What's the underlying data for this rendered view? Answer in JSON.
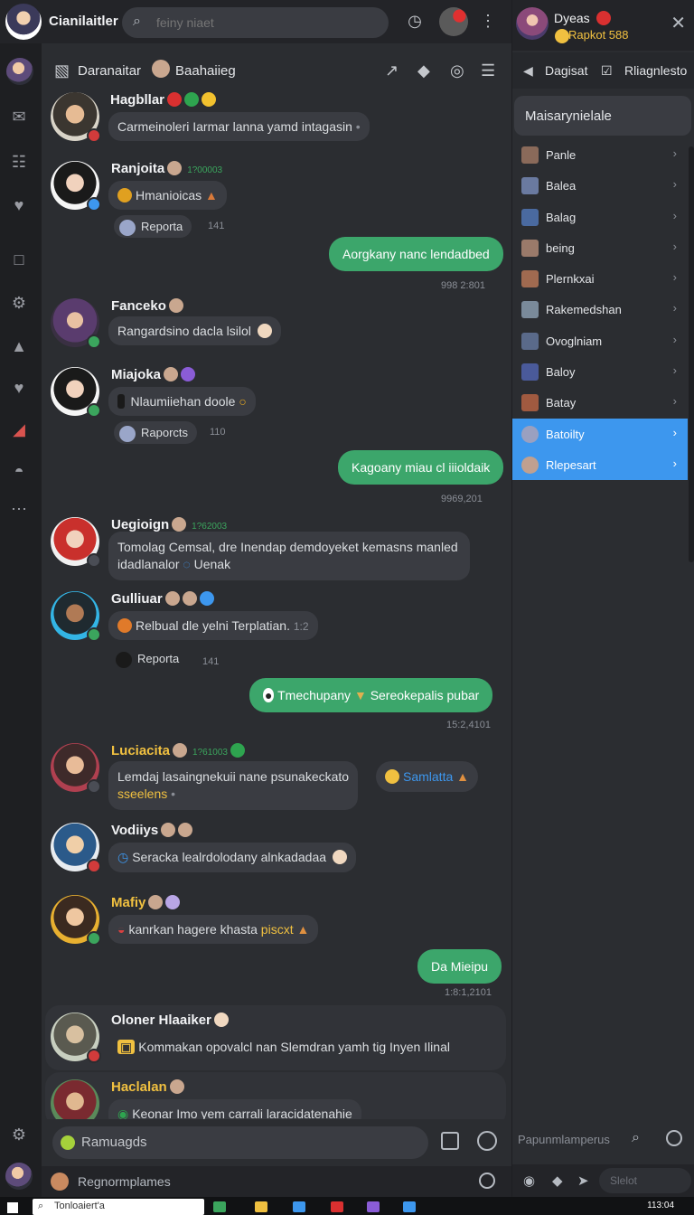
{
  "app": {
    "title": "Cianilaitler"
  },
  "search": {
    "placeholder": "feiny niaet"
  },
  "channel": {
    "name": "Daranaitar",
    "subname": "Baahaiieg"
  },
  "messages": [
    {
      "name": "Hagbllar",
      "meta": "",
      "text": "Carmeinoleri Iarmar lanna yamd intagasin",
      "reply": null,
      "rnum": ""
    },
    {
      "name": "Ranjoita",
      "meta": "1?00003",
      "text": "Hmanioicas",
      "reply": "Reporta",
      "rnum": "141"
    },
    {
      "name": "Fanceko",
      "meta": "",
      "text": "Rangardsino dacla lsilol",
      "reply": null,
      "rnum": ""
    },
    {
      "name": "Miajoka",
      "meta": "",
      "text": "Nlaumiiehan doole",
      "reply": "Raporcts",
      "rnum": "110"
    },
    {
      "name": "Uegioign",
      "meta": "1?62003",
      "text": "Tomolag Cemsal, dre Inendap demdoyeket kemasns manled",
      "text2": "idadlanalor",
      "text3": "Uenak",
      "reply": null,
      "rnum": ""
    },
    {
      "name": "Gulliuar",
      "meta": "",
      "text": "Relbual dle yelni Terplatian.",
      "text2": "1:2",
      "reply": "Reporta",
      "rnum": "141"
    },
    {
      "name": "Luciacita",
      "meta": "1?61003",
      "text": "Lemdaj lasaingnekuii nane psunakeckato",
      "text2": "sseelens",
      "reply": null,
      "rnum": ""
    },
    {
      "name": "Vodiiys",
      "meta": "",
      "text": "Seracka lealrdolodany alnkadadaa",
      "reply": null,
      "rnum": ""
    },
    {
      "name": "Mafiy",
      "meta": "",
      "text": "kanrkan hagere khasta",
      "text2": "piscxt",
      "reply": null,
      "rnum": ""
    },
    {
      "name": "Oloner Hlaaiker",
      "meta": "",
      "text": "Kommakan opovalcl nan Slemdran yamh tig Inyen Ilinal",
      "reply": null,
      "rnum": ""
    },
    {
      "name": "Haclalan",
      "meta": "",
      "text": "Keonar Imo yem carrali laracidatenahie",
      "reply": null,
      "rnum": ""
    }
  ],
  "outgoing": [
    {
      "text": "Aorgkany nanc lendadbed",
      "time": "998 2:801"
    },
    {
      "text": "Kagoany miau cl iiioldaik",
      "time": "9969,201"
    },
    {
      "text": "Tmechupany",
      "text2": "Sereokepalis pubar",
      "time": "15:2,4101"
    },
    {
      "text": "Samlatta",
      "time": ""
    },
    {
      "text": "Da Mieipu",
      "time": "1:8:1,2101"
    }
  ],
  "composer": {
    "placeholder": "Ramuagds"
  },
  "bottom": {
    "placeholder": "Regnormplames"
  },
  "panel": {
    "user": "Dyeas",
    "subtitle": "Rapkot 588",
    "tab1": "Dagisat",
    "tab2": "Rliagnlesto",
    "select": "Maisarynielale",
    "items": [
      "Panle",
      "Balea",
      "Balag",
      "being",
      "Plernkxai",
      "Rakemedshan",
      "Ovoglniam",
      "Baloy",
      "Batay",
      "Batoilty",
      "Rlepesart"
    ],
    "selected": [
      "Batoilty",
      "Rlepesart"
    ],
    "search_placeholder": "Papunmlamperus",
    "foot_search": "Slelot"
  },
  "taskbar": {
    "search": "Tonloaiert'a",
    "clock": "113:04"
  },
  "colors": {
    "accent_green": "#3ca66b",
    "select_blue": "#3d97ee",
    "bg": "#2b2d31"
  }
}
